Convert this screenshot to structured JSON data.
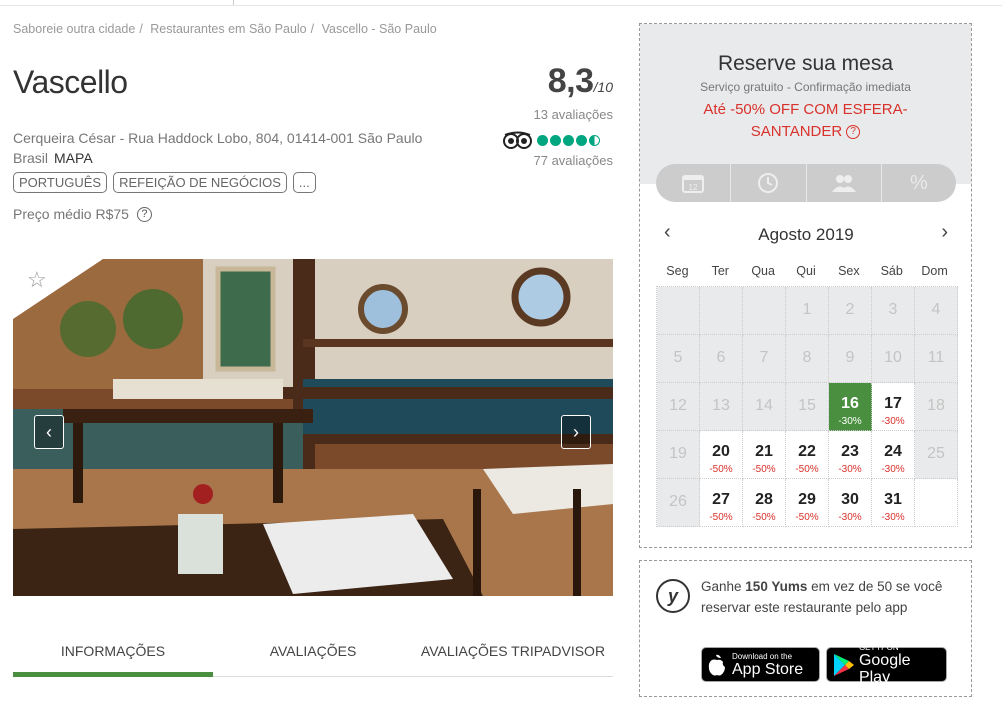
{
  "breadcrumb": [
    "Saboreie outra cidade",
    "Restaurantes em São Paulo",
    "Vascello - São Paulo"
  ],
  "restaurant": {
    "name": "Vascello",
    "score": "8,3",
    "score_max": "/10",
    "reviews": "13 avaliações",
    "tripadvisor_reviews": "77 avaliações",
    "tripadvisor_rating": 4.5,
    "address_line1": "Cerqueira César - Rua Haddock Lobo, 804, 01414-001 São Paulo",
    "address_line2": "Brasil",
    "map_link": "MAPA",
    "tags": [
      "PORTUGUÊS",
      "REFEIÇÃO DE NEGÓCIOS",
      "..."
    ],
    "price": "Preço médio R$75"
  },
  "tabs": [
    "INFORMAÇÕES",
    "AVALIAÇÕES",
    "AVALIAÇÕES TRIPADVISOR"
  ],
  "reserve": {
    "title": "Reserve sua mesa",
    "subtitle": "Serviço gratuito - Confirmação imediata",
    "promo": "Até -50% OFF COM ESFERA-SANTANDER",
    "steps": [
      "calendar-icon",
      "clock-icon",
      "people-icon",
      "percent-icon"
    ],
    "month": "Agosto 2019",
    "weekdays": [
      "Seg",
      "Ter",
      "Qua",
      "Qui",
      "Sex",
      "Sáb",
      "Dom"
    ],
    "weeks": [
      [
        {
          "n": ""
        },
        {
          "n": ""
        },
        {
          "n": ""
        },
        {
          "n": "1"
        },
        {
          "n": "2"
        },
        {
          "n": "3"
        },
        {
          "n": "4"
        }
      ],
      [
        {
          "n": "5"
        },
        {
          "n": "6"
        },
        {
          "n": "7"
        },
        {
          "n": "8"
        },
        {
          "n": "9"
        },
        {
          "n": "10"
        },
        {
          "n": "11"
        }
      ],
      [
        {
          "n": "12"
        },
        {
          "n": "13"
        },
        {
          "n": "14"
        },
        {
          "n": "15"
        },
        {
          "n": "16",
          "d": "-30%",
          "sel": true
        },
        {
          "n": "17",
          "d": "-30%"
        },
        {
          "n": "18"
        }
      ],
      [
        {
          "n": "19"
        },
        {
          "n": "20",
          "d": "-50%"
        },
        {
          "n": "21",
          "d": "-50%"
        },
        {
          "n": "22",
          "d": "-50%"
        },
        {
          "n": "23",
          "d": "-30%"
        },
        {
          "n": "24",
          "d": "-30%"
        },
        {
          "n": "25"
        }
      ],
      [
        {
          "n": "26"
        },
        {
          "n": "27",
          "d": "-50%"
        },
        {
          "n": "28",
          "d": "-50%"
        },
        {
          "n": "29",
          "d": "-50%"
        },
        {
          "n": "30",
          "d": "-30%"
        },
        {
          "n": "31",
          "d": "-30%"
        },
        {
          "n": "",
          "white": true
        }
      ]
    ]
  },
  "yums": {
    "prefix": "Ganhe ",
    "amount": "150 Yums",
    "suffix": " em vez de 50 se você reservar este restaurante pelo app",
    "appstore_small": "Download on the",
    "appstore_large": "App Store",
    "googleplay_small": "GET IT ON",
    "googleplay_large": "Google Play"
  },
  "colors": {
    "accent_green": "#4a8f3f",
    "promo_red": "#d9312b",
    "tripadvisor_green": "#00a680"
  }
}
